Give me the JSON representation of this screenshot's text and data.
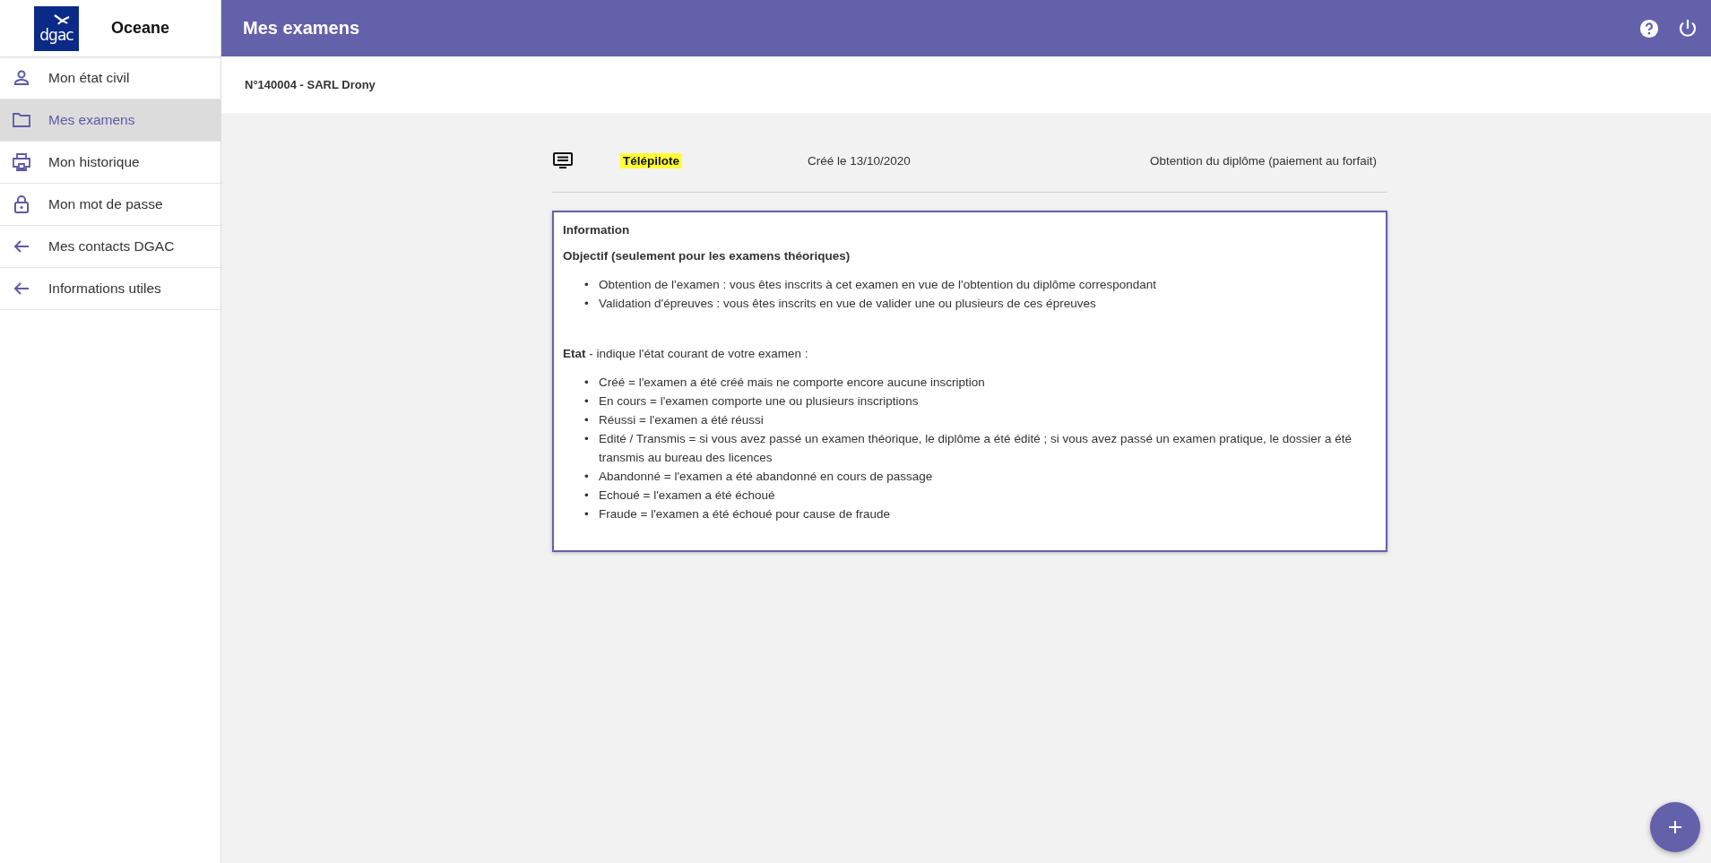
{
  "app": {
    "logo_text": "dgac",
    "name": "Oceane"
  },
  "sidebar": {
    "items": [
      {
        "label": "Mon état civil",
        "selected": false
      },
      {
        "label": "Mes examens",
        "selected": true
      },
      {
        "label": "Mon historique",
        "selected": false
      },
      {
        "label": "Mon mot de passe",
        "selected": false
      },
      {
        "label": "Mes contacts DGAC",
        "selected": false
      },
      {
        "label": "Informations utiles",
        "selected": false
      }
    ]
  },
  "header": {
    "title": "Mes examens"
  },
  "subheader": {
    "text": "N°140004 - SARL Drony"
  },
  "exam": {
    "name": "Télépilote",
    "created": "Créé le 13/10/2020",
    "type": "Obtention du diplôme (paiement au forfait)"
  },
  "info": {
    "title": "Information",
    "objective_heading": "Objectif (seulement pour les examens théoriques)",
    "objective_items": [
      {
        "bullet": "•",
        "text": "Obtention de l'examen : vous êtes inscrits à cet examen en vue de l'obtention du diplôme correspondant"
      },
      {
        "bullet": "•",
        "text": "Validation d'épreuves : vous êtes inscrits en vue de valider une ou plusieurs de ces épreuves"
      }
    ],
    "state_intro": "**Etat** - indique l'état courant de votre examen :",
    "state_items": [
      {
        "bullet": "•",
        "text": "Créé = l'examen a été créé mais ne comporte encore aucune inscription"
      },
      {
        "bullet": "•",
        "text": "En cours = l'examen comporte une ou plusieurs inscriptions"
      },
      {
        "bullet": "•",
        "text": "Réussi = l'examen a été réussi"
      },
      {
        "bullet": "•",
        "text": "Edité / Transmis = si vous avez passé un examen théorique, le diplôme a été édité ; si vous avez passé un examen pratique, le dossier a été transmis au bureau des licences"
      },
      {
        "bullet": "•",
        "text": "Abandonné = l'examen a été abandonné en cours de passage"
      },
      {
        "bullet": "•",
        "text": "Echoué = l'examen a été échoué"
      },
      {
        "bullet": "•",
        "text": "Fraude = l'examen a été échoué pour cause de fraude"
      }
    ]
  }
}
